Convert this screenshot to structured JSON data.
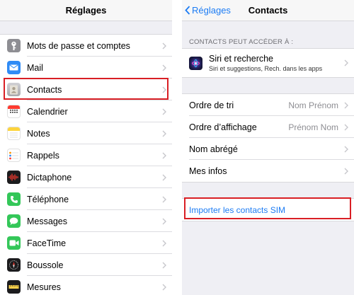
{
  "left": {
    "title": "Réglages",
    "items": [
      {
        "label": "Mots de passe et comptes",
        "icon": "key-icon",
        "color": "#8e8e93"
      },
      {
        "label": "Mail",
        "icon": "mail-icon",
        "color": "#2f8bf5"
      },
      {
        "label": "Contacts",
        "icon": "contacts-icon",
        "color": "#b8b8bc"
      },
      {
        "label": "Calendrier",
        "icon": "calendar-icon",
        "color": "#ffffff"
      },
      {
        "label": "Notes",
        "icon": "notes-icon",
        "color": "#fdd43c"
      },
      {
        "label": "Rappels",
        "icon": "reminders-icon",
        "color": "#ffffff"
      },
      {
        "label": "Dictaphone",
        "icon": "voice-memos-icon",
        "color": "#1c1c1e"
      },
      {
        "label": "Téléphone",
        "icon": "phone-icon",
        "color": "#34c759"
      },
      {
        "label": "Messages",
        "icon": "messages-icon",
        "color": "#34c759"
      },
      {
        "label": "FaceTime",
        "icon": "facetime-icon",
        "color": "#34c759"
      },
      {
        "label": "Boussole",
        "icon": "compass-icon",
        "color": "#1c1c1e"
      },
      {
        "label": "Mesures",
        "icon": "measure-icon",
        "color": "#1c1c1e"
      }
    ]
  },
  "right": {
    "back_label": "Réglages",
    "title": "Contacts",
    "section_header": "CONTACTS PEUT ACCÉDER À :",
    "siri": {
      "title": "Siri et recherche",
      "subtitle": "Siri et suggestions, Rech. dans les apps",
      "icon": "siri-icon"
    },
    "settings": [
      {
        "label": "Ordre de tri",
        "value": "Nom Prénom"
      },
      {
        "label": "Ordre d’affichage",
        "value": "Prénom Nom"
      },
      {
        "label": "Nom abrégé",
        "value": ""
      },
      {
        "label": "Mes infos",
        "value": ""
      }
    ],
    "import_label": "Importer les contacts SIM"
  },
  "colors": {
    "accent": "#1c7cf4",
    "highlight": "#d91f25",
    "background": "#efeff4"
  }
}
